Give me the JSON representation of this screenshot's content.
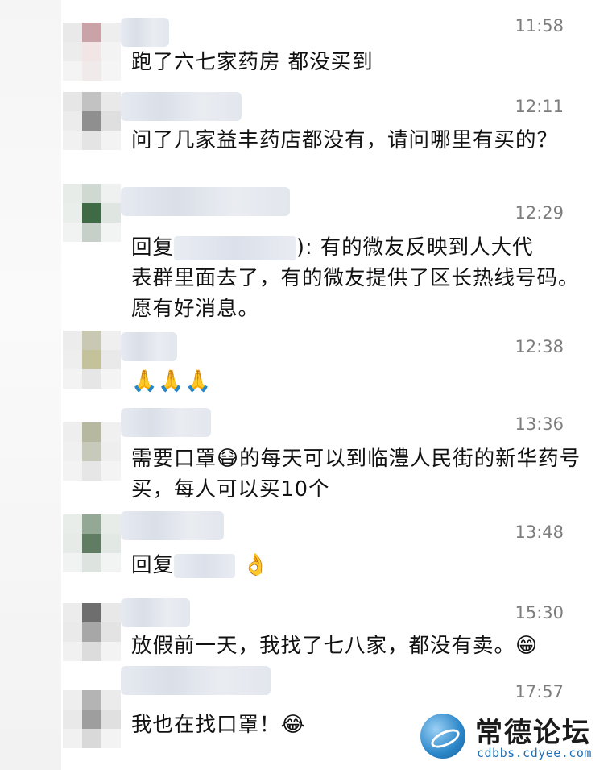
{
  "messages": [
    {
      "time": "11:58",
      "text": "跑了六七家药房 都没买到"
    },
    {
      "time": "12:11",
      "text": "问了几家益丰药店都没有，请问哪里有买的？"
    },
    {
      "time": "12:29",
      "reply_prefix": "回复",
      "text_line1": "): 有的微友反映到人大代",
      "text_rest": "表群里面去了，有的微友提供了区长热线号码。愿有好消息。"
    },
    {
      "time": "12:38",
      "emoji": "🙏🙏🙏"
    },
    {
      "time": "13:36",
      "text_a": "需要口罩",
      "emoji": "😷",
      "text_b": "的每天可以到临澧人民街的新华药号买，每人可以买10个"
    },
    {
      "time": "13:48",
      "reply_prefix": "回复",
      "emoji": "👌"
    },
    {
      "time": "15:30",
      "text": "放假前一天，我找了七八家，都没有卖。",
      "emoji": "😁"
    },
    {
      "time": "17:57",
      "text": "我也在找口罩！",
      "emoji": "😂"
    }
  ],
  "watermark": {
    "title": "常德论坛",
    "url": "cdbbs.cdyee.com",
    "logo_icon": "globe-logo-icon"
  },
  "colors": {
    "time": "#7d7d7d",
    "text": "#111111",
    "watermark_url": "#1f6fb4"
  }
}
